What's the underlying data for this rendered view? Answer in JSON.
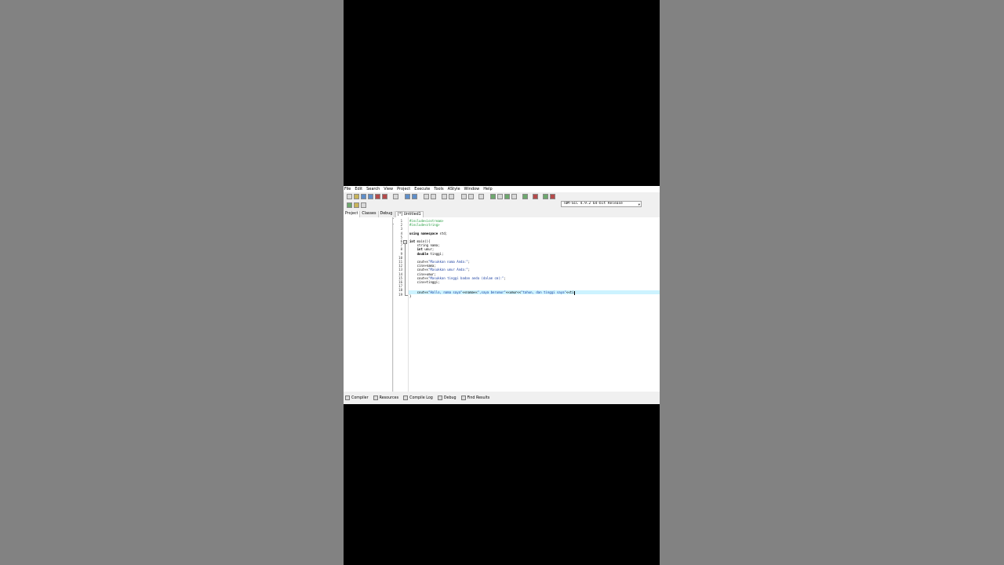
{
  "menu": [
    "File",
    "Edit",
    "Search",
    "View",
    "Project",
    "Execute",
    "Tools",
    "AStyle",
    "Window",
    "Help"
  ],
  "toolbar": {
    "compiler": "TDM-GCC 4.9.2 64-bit Release",
    "scope": "(globals)",
    "function": ""
  },
  "left_tabs": [
    "Project",
    "Classes",
    "Debug"
  ],
  "editor_tab": "[*] Untitled1",
  "line_numbers": [
    "1",
    "2",
    "3",
    "4",
    "5",
    "6",
    "7",
    "8",
    "9",
    "10",
    "11",
    "12",
    "13",
    "14",
    "15",
    "16",
    "17",
    "18",
    "19"
  ],
  "code": {
    "l1": "#include<iostream>",
    "l2": "#include<string>",
    "l4a": "using namespace",
    "l4b": " std;",
    "l6a": "int",
    "l6b": " main(){",
    "l7a": "    string",
    "l7b": " nama;",
    "l8a": "    int",
    "l8b": " umur;",
    "l9a": "    double",
    "l9b": " tinggi;",
    "l11a": "    cout<<",
    "l11b": "\"Masukkan nama Anda:\"",
    "l11c": ";",
    "l12": "    cin>>nama;",
    "l13a": "    cout<<",
    "l13b": "\"Masukkan umur Anda:\"",
    "l13c": ";",
    "l14": "    cin>>umur;",
    "l15a": "    cout<<",
    "l15b": "\"Masukkan tinggi badan anda (dalam cm):\"",
    "l15c": ";",
    "l16": "    cin>>tinggi;",
    "l18a": "    cout<<",
    "l18b": "\"Hallo, nama saya\"",
    "l18c": "<<nama<<",
    "l18d": "\",saya berumur\"",
    "l18e": "<<umur<<",
    "l18f": "\"tahun, dan tinggi saya\"",
    "l18g": "<<ti",
    "l19": "}"
  },
  "bottom_tabs": [
    "Compiler",
    "Resources",
    "Compile Log",
    "Debug",
    "Find Results"
  ],
  "colors": {
    "preprocessor": "#1f9a3a",
    "string": "#1a3fa0",
    "current_line": "#ccf3ff"
  }
}
